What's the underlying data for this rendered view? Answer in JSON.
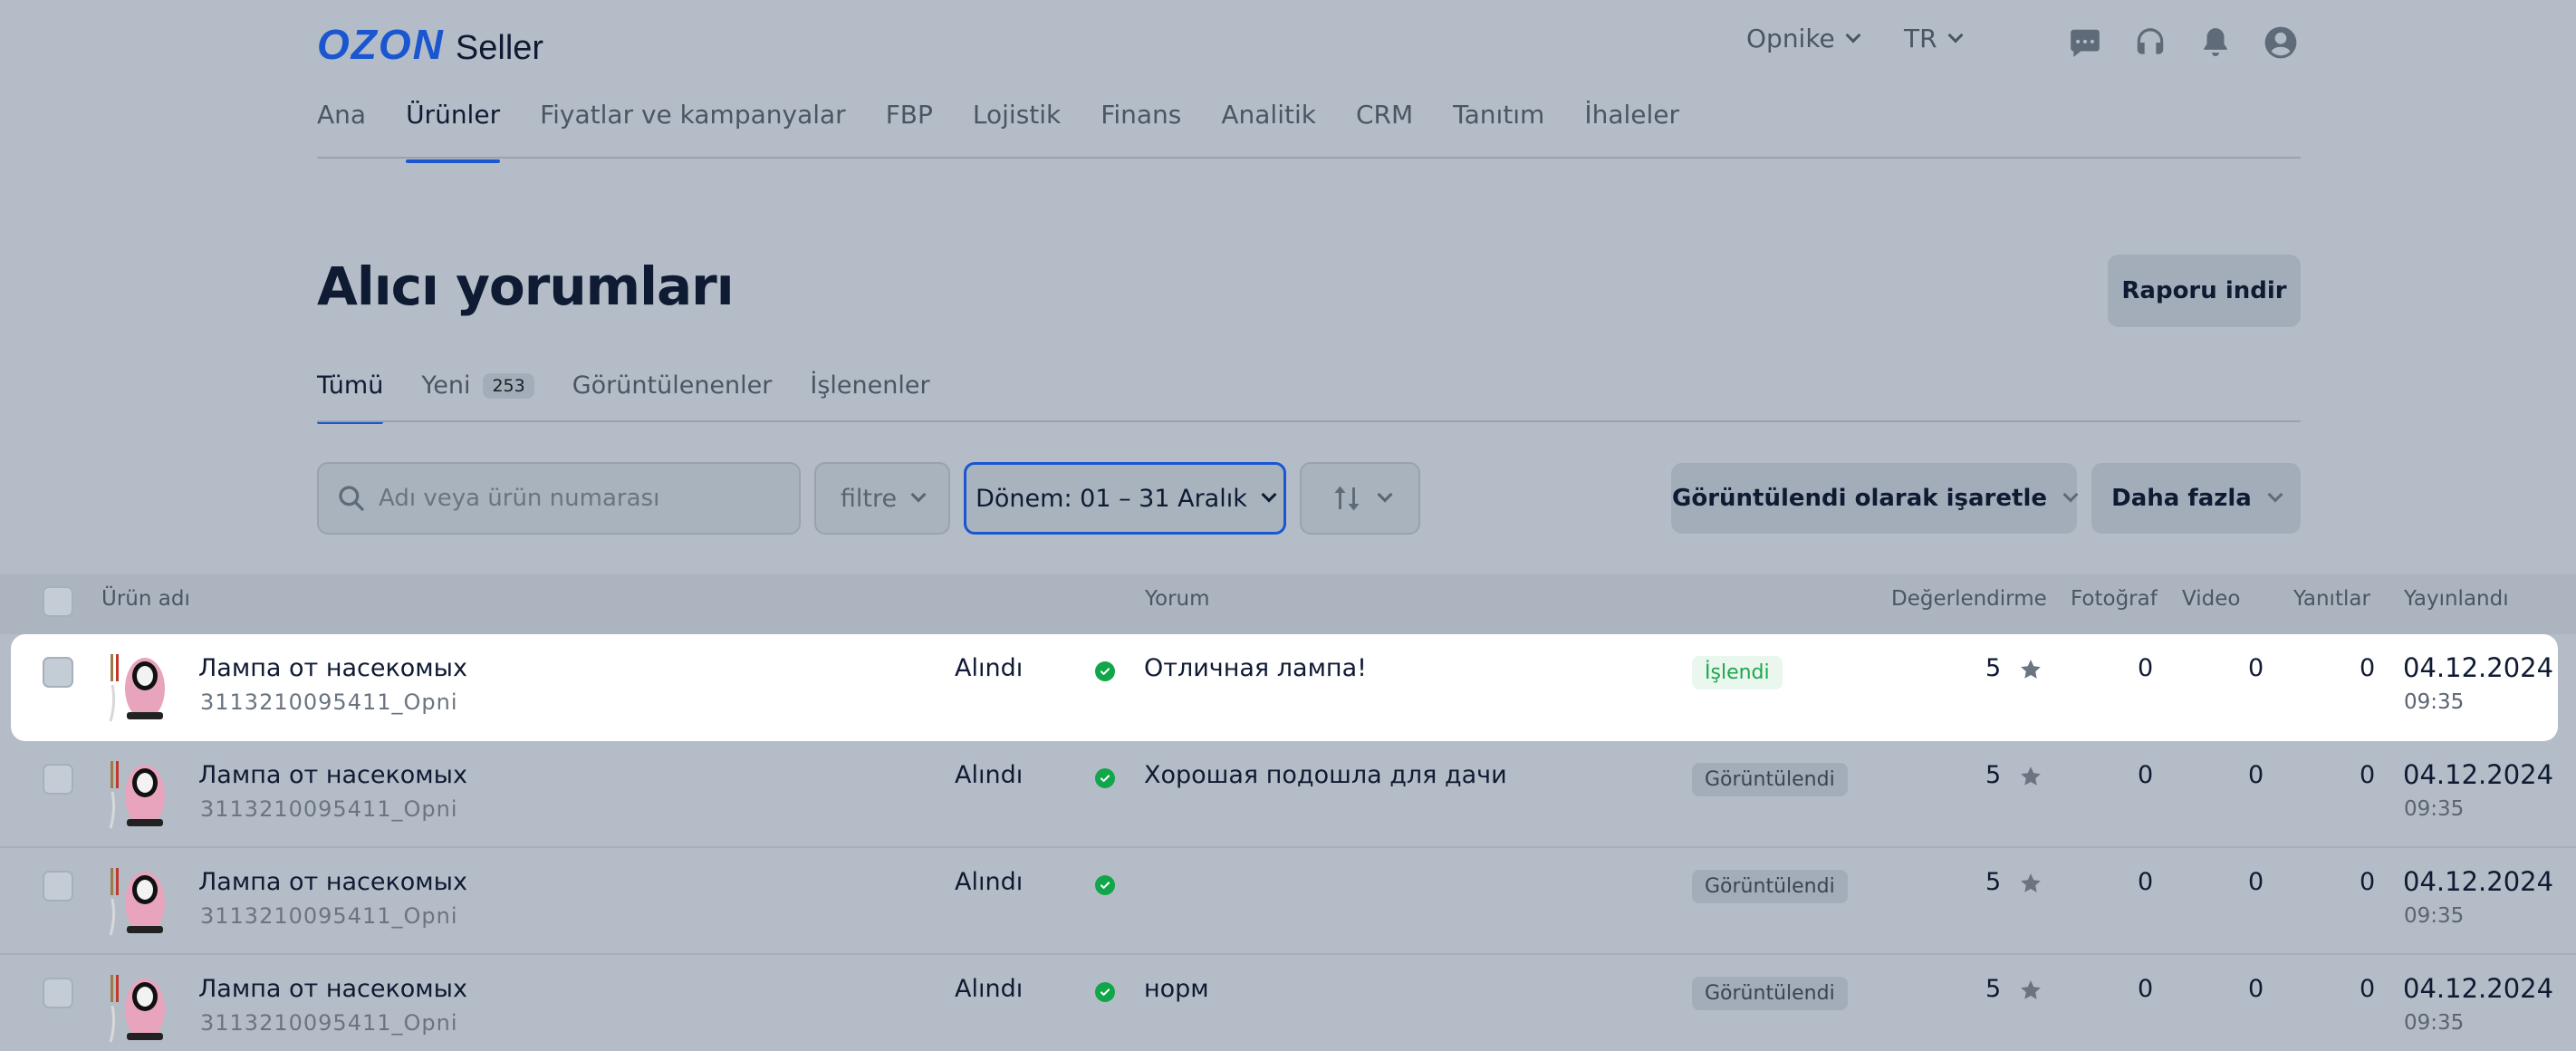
{
  "header": {
    "logo_main": "OZON",
    "logo_sub": "Seller",
    "shop": "Opnike",
    "language": "TR",
    "icons": [
      "chat-icon",
      "headset-icon",
      "bell-icon",
      "user-icon"
    ]
  },
  "nav": {
    "items": [
      "Ana",
      "Ürünler",
      "Fiyatlar ve kampanyalar",
      "FBP",
      "Lojistik",
      "Finans",
      "Analitik",
      "CRM",
      "Tanıtım",
      "İhaleler"
    ],
    "active": "Ürünler"
  },
  "page": {
    "title": "Alıcı yorumları",
    "report_button": "Raporu indir"
  },
  "tabs": {
    "all": "Tümü",
    "new": "Yeni",
    "new_count": "253",
    "viewed": "Görüntülenenler",
    "processed": "İşlenenler"
  },
  "filters": {
    "search_placeholder": "Adı veya ürün numarası",
    "filter_label": "filtre",
    "period_label": "Dönem: 01 – 31 Aralık",
    "mark_viewed": "Görüntülendi olarak işaretle",
    "more": "Daha fazla"
  },
  "table": {
    "headers": {
      "product": "Ürün adı",
      "comment": "Yorum",
      "rating": "Değerlendirme",
      "photo": "Fotoğraf",
      "video": "Video",
      "replies": "Yanıtlar",
      "published": "Yayınlandı"
    },
    "rows": [
      {
        "name": "Лампа от насекомых",
        "sku": "3113210095411_Opni",
        "status": "Alındı",
        "comment": "Отличная лампа!",
        "state": "İşlendi",
        "rating": "5",
        "photo": "0",
        "video": "0",
        "replies": "0",
        "date": "04.12.2024",
        "time": "09:35"
      },
      {
        "name": "Лампа от насекомых",
        "sku": "3113210095411_Opni",
        "status": "Alındı",
        "comment": "Хорошая подошла для дачи",
        "state": "Görüntülendi",
        "rating": "5",
        "photo": "0",
        "video": "0",
        "replies": "0",
        "date": "04.12.2024",
        "time": "09:35"
      },
      {
        "name": "Лампа от насекомых",
        "sku": "3113210095411_Opni",
        "status": "Alındı",
        "comment": "",
        "state": "Görüntülendi",
        "rating": "5",
        "photo": "0",
        "video": "0",
        "replies": "0",
        "date": "04.12.2024",
        "time": "09:35"
      },
      {
        "name": "Лампа от насекомых",
        "sku": "3113210095411_Opni",
        "status": "Alındı",
        "comment": "норм",
        "state": "Görüntülendi",
        "rating": "5",
        "photo": "0",
        "video": "0",
        "replies": "0",
        "date": "04.12.2024",
        "time": "09:35"
      }
    ]
  },
  "colors": {
    "accent": "#1a56d0",
    "success": "#11a64a",
    "overlay_bg": "#b4bdc7"
  }
}
